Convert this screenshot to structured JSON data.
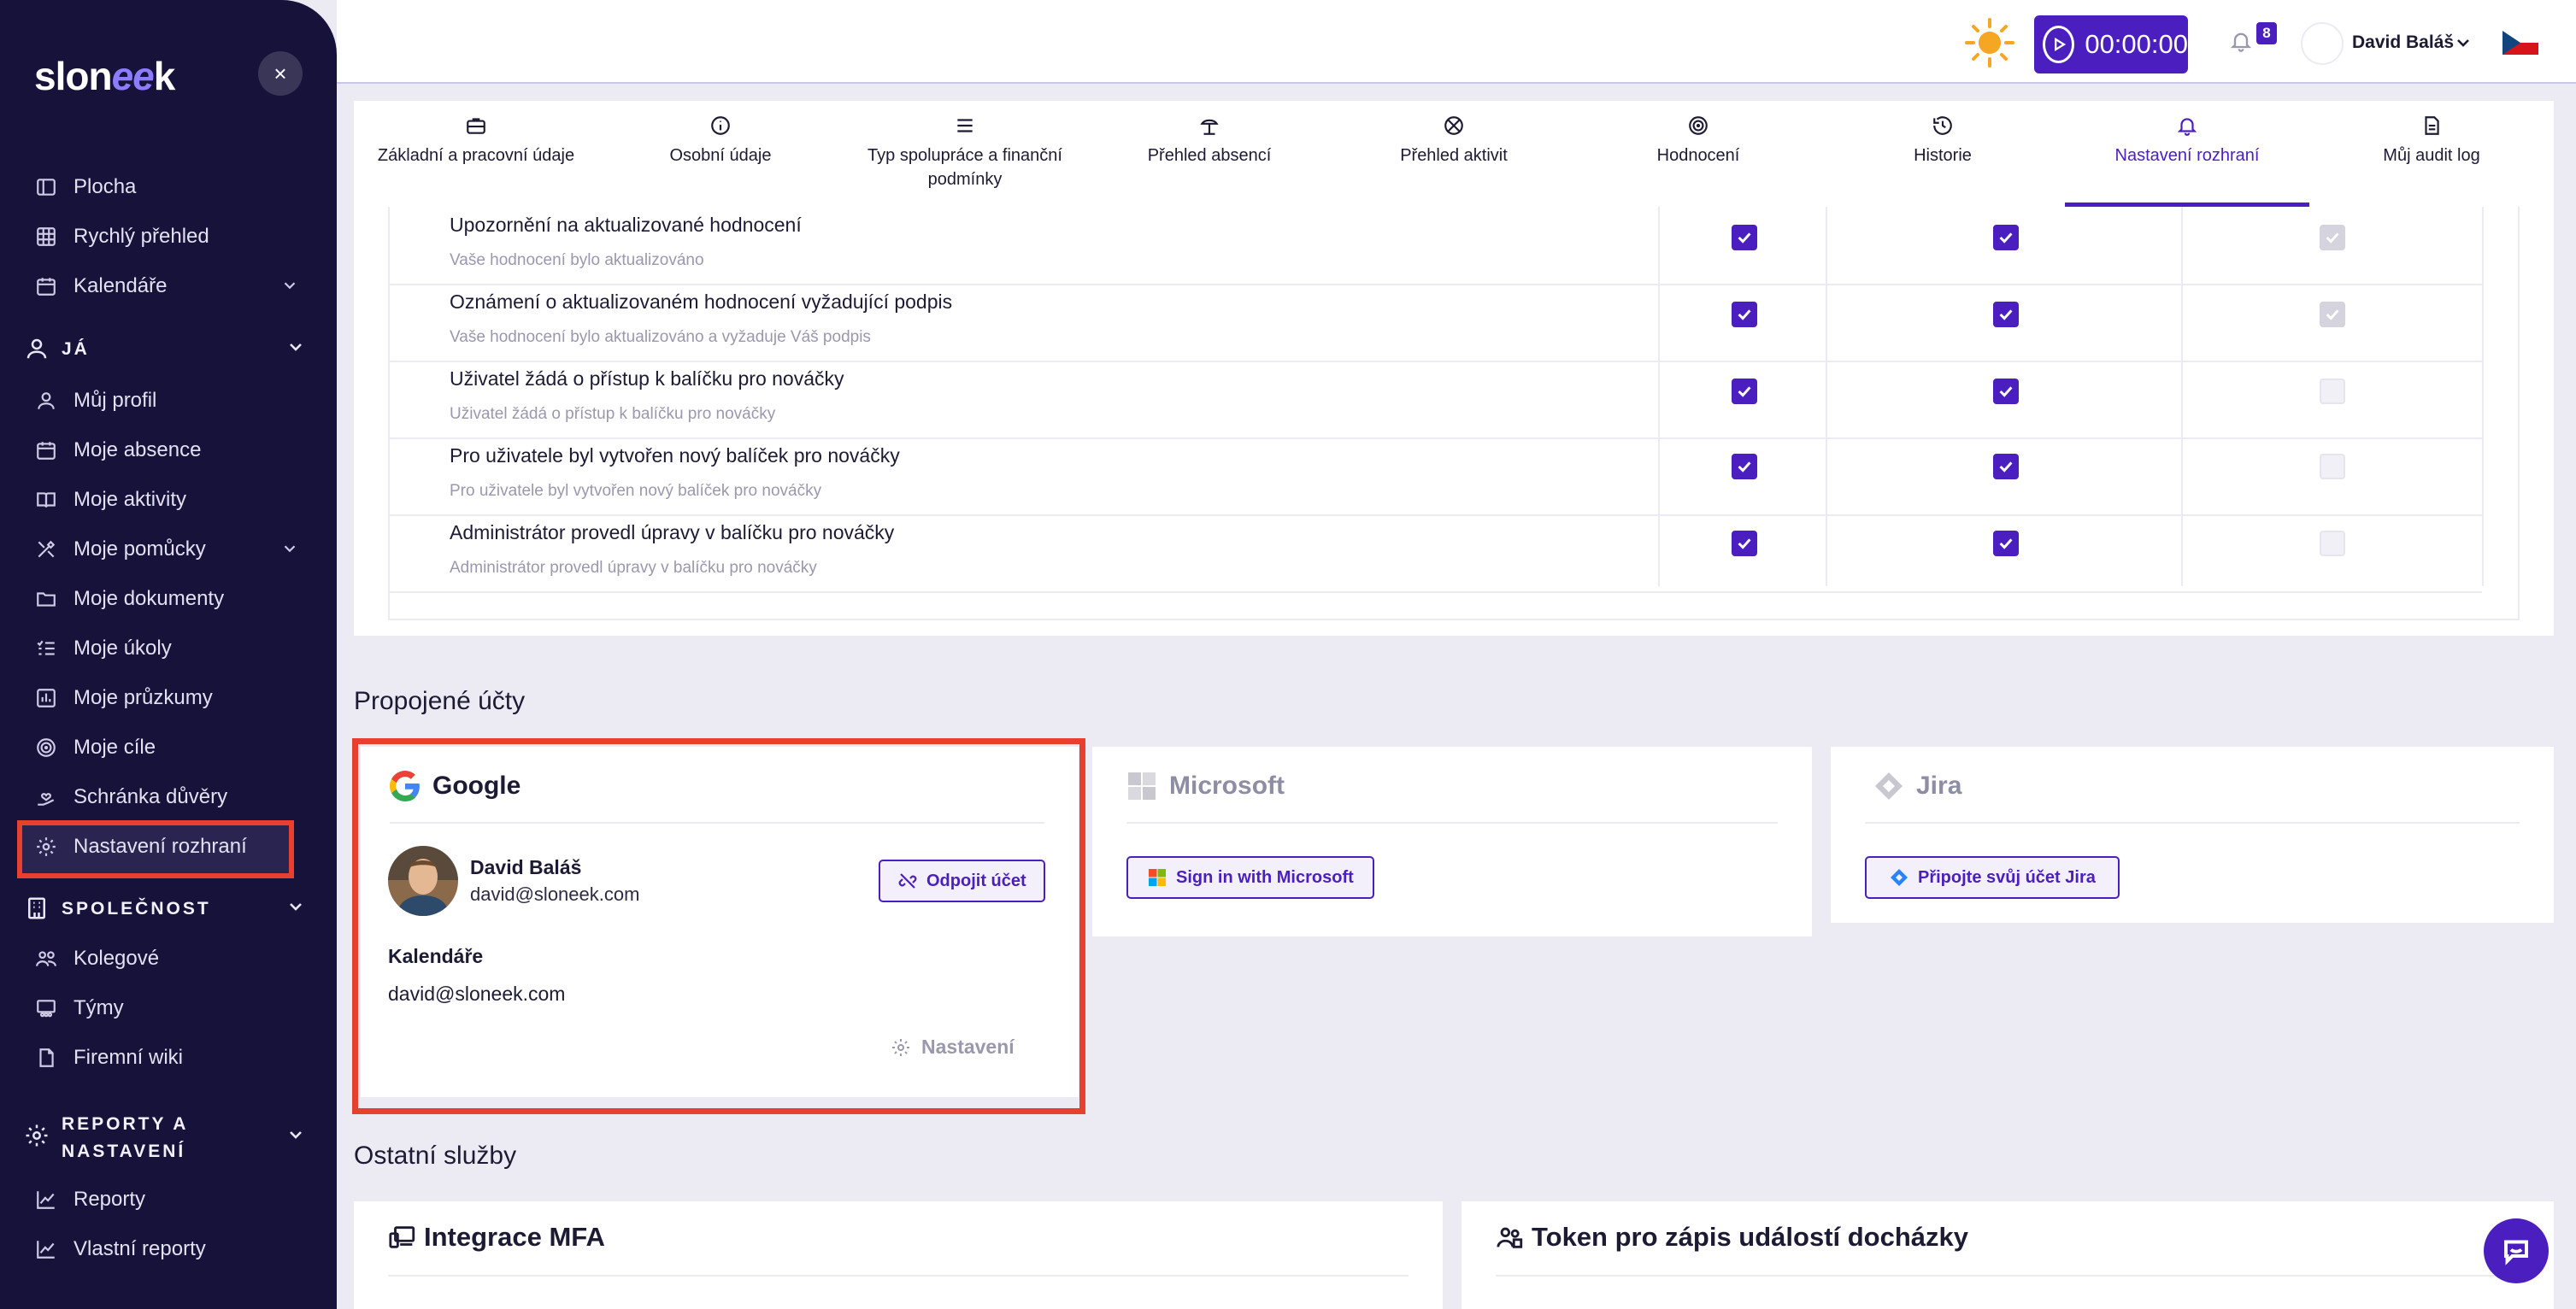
{
  "sidebar": {
    "logo": {
      "a": "slon",
      "b": "ee",
      "c": "k"
    },
    "close": "×",
    "items_top": [
      {
        "label": "Plocha",
        "icon": "dashboard-icon"
      },
      {
        "label": "Rychlý přehled",
        "icon": "grid-icon"
      },
      {
        "label": "Kalendáře",
        "icon": "calendar-icon"
      }
    ],
    "section_me": "JÁ",
    "items_me": [
      {
        "label": "Můj profil"
      },
      {
        "label": "Moje absence"
      },
      {
        "label": "Moje aktivity"
      },
      {
        "label": "Moje pomůcky"
      },
      {
        "label": "Moje dokumenty"
      },
      {
        "label": "Moje úkoly"
      },
      {
        "label": "Moje průzkumy"
      },
      {
        "label": "Moje cíle"
      },
      {
        "label": "Schránka důvěry"
      },
      {
        "label": "Nastavení rozhraní"
      }
    ],
    "section_company": "SPOLEČNOST",
    "items_company": [
      {
        "label": "Kolegové"
      },
      {
        "label": "Týmy"
      },
      {
        "label": "Firemní wiki"
      }
    ],
    "section_reports_1": "REPORTY A",
    "section_reports_2": "NASTAVENÍ",
    "items_reports": [
      {
        "label": "Reporty"
      },
      {
        "label": "Vlastní reporty"
      }
    ]
  },
  "topbar": {
    "timer": "00:00:00",
    "notif_count": "8",
    "user_name": "David Baláš"
  },
  "tabs": [
    {
      "label": "Základní a pracovní údaje"
    },
    {
      "label": "Osobní údaje"
    },
    {
      "label": "Typ spolupráce a finanční podmínky"
    },
    {
      "label": "Přehled absencí"
    },
    {
      "label": "Přehled aktivit"
    },
    {
      "label": "Hodnocení"
    },
    {
      "label": "Historie"
    },
    {
      "label": "Nastavení rozhraní"
    },
    {
      "label": "Můj audit log"
    }
  ],
  "notifications": [
    {
      "title": "Upozornění na aktualizované hodnocení",
      "desc": "Vaše hodnocení bylo aktualizováno",
      "c1": "on",
      "c2": "on",
      "c3": "dis"
    },
    {
      "title": "Oznámení o aktualizovaném hodnocení vyžadující podpis",
      "desc": "Vaše hodnocení bylo aktualizováno a vyžaduje Váš podpis",
      "c1": "on",
      "c2": "on",
      "c3": "dis"
    },
    {
      "title": "Uživatel žádá o přístup k balíčku pro nováčky",
      "desc": "Uživatel žádá o přístup k balíčku pro nováčky",
      "c1": "on",
      "c2": "on",
      "c3": "off"
    },
    {
      "title": "Pro uživatele byl vytvořen nový balíček pro nováčky",
      "desc": "Pro uživatele byl vytvořen nový balíček pro nováčky",
      "c1": "on",
      "c2": "on",
      "c3": "off"
    },
    {
      "title": "Administrátor provedl úpravy v balíčku pro nováčky",
      "desc": "Administrátor provedl úpravy v balíčku pro nováčky",
      "c1": "on",
      "c2": "on",
      "c3": "off"
    }
  ],
  "connected": {
    "title": "Propojené účty",
    "google": {
      "name": "Google",
      "user_name": "David Baláš",
      "user_email": "david@sloneek.com",
      "disconnect": "Odpojit účet",
      "calendars_label": "Kalendáře",
      "calendar_email": "david@sloneek.com",
      "settings": "Nastavení"
    },
    "microsoft": {
      "name": "Microsoft",
      "button": "Sign in with Microsoft"
    },
    "jira": {
      "name": "Jira",
      "button": "Připojte svůj účet Jira"
    }
  },
  "other": {
    "title": "Ostatní služby",
    "mfa": "Integrace MFA",
    "token": "Token pro zápis událostí docházky"
  },
  "colors": {
    "accent": "#4b1fbf",
    "sidebar": "#17123a",
    "highlight": "#e8402e"
  }
}
